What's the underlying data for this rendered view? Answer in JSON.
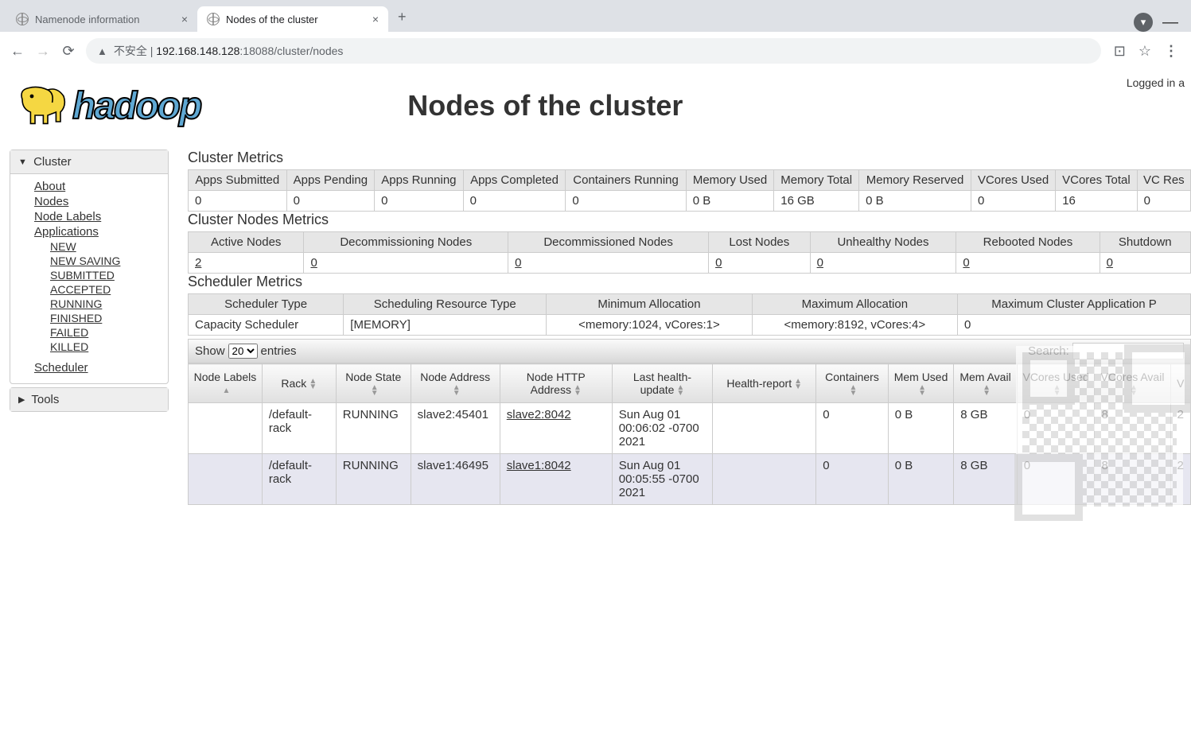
{
  "browser": {
    "tabs": [
      {
        "title": "Namenode information",
        "active": false
      },
      {
        "title": "Nodes of the cluster",
        "active": true
      }
    ],
    "security_text": "不安全",
    "url_host": "192.168.148.128",
    "url_port_path": ":18088/cluster/nodes"
  },
  "login_status": "Logged in a",
  "logo_text": "hadoop",
  "page_title": "Nodes of the cluster",
  "sidebar": {
    "cluster_label": "Cluster",
    "about": "About",
    "nodes": "Nodes",
    "node_labels": "Node Labels",
    "applications": "Applications",
    "app_states": [
      "NEW",
      "NEW SAVING",
      "SUBMITTED",
      "ACCEPTED",
      "RUNNING",
      "FINISHED",
      "FAILED",
      "KILLED"
    ],
    "scheduler": "Scheduler",
    "tools_label": "Tools"
  },
  "sections": {
    "cluster_metrics": "Cluster Metrics",
    "cluster_nodes_metrics": "Cluster Nodes Metrics",
    "scheduler_metrics": "Scheduler Metrics"
  },
  "cluster_metrics": {
    "headers": [
      "Apps Submitted",
      "Apps Pending",
      "Apps Running",
      "Apps Completed",
      "Containers Running",
      "Memory Used",
      "Memory Total",
      "Memory Reserved",
      "VCores Used",
      "VCores Total",
      "VC Res"
    ],
    "values": [
      "0",
      "0",
      "0",
      "0",
      "0",
      "0 B",
      "16 GB",
      "0 B",
      "0",
      "16",
      "0"
    ]
  },
  "nodes_metrics": {
    "headers": [
      "Active Nodes",
      "Decommissioning Nodes",
      "Decommissioned Nodes",
      "Lost Nodes",
      "Unhealthy Nodes",
      "Rebooted Nodes",
      "Shutdown"
    ],
    "values": [
      "2",
      "0",
      "0",
      "0",
      "0",
      "0",
      "0"
    ]
  },
  "scheduler_metrics": {
    "headers": [
      "Scheduler Type",
      "Scheduling Resource Type",
      "Minimum Allocation",
      "Maximum Allocation",
      "Maximum Cluster Application P"
    ],
    "values": [
      "Capacity Scheduler",
      "[MEMORY]",
      "<memory:1024, vCores:1>",
      "<memory:8192, vCores:4>",
      "0"
    ]
  },
  "datatable": {
    "show_label": "Show",
    "show_value": "20",
    "entries_label": "entries",
    "search_label": "Search:",
    "headers": [
      "Node Labels",
      "Rack",
      "Node State",
      "Node Address",
      "Node HTTP Address",
      "Last health-update",
      "Health-report",
      "Containers",
      "Mem Used",
      "Mem Avail",
      "VCores Used",
      "VCores Avail",
      "V"
    ],
    "rows": [
      {
        "labels": "",
        "rack": "/default-rack",
        "state": "RUNNING",
        "addr": "slave2:45401",
        "http": "slave2:8042",
        "health": "Sun Aug 01 00:06:02 -0700 2021",
        "report": "",
        "containers": "0",
        "mem_used": "0 B",
        "mem_avail": "8 GB",
        "vc_used": "0",
        "vc_avail": "8",
        "v": "2"
      },
      {
        "labels": "",
        "rack": "/default-rack",
        "state": "RUNNING",
        "addr": "slave1:46495",
        "http": "slave1:8042",
        "health": "Sun Aug 01 00:05:55 -0700 2021",
        "report": "",
        "containers": "0",
        "mem_used": "0 B",
        "mem_avail": "8 GB",
        "vc_used": "0",
        "vc_avail": "8",
        "v": "2"
      }
    ]
  }
}
